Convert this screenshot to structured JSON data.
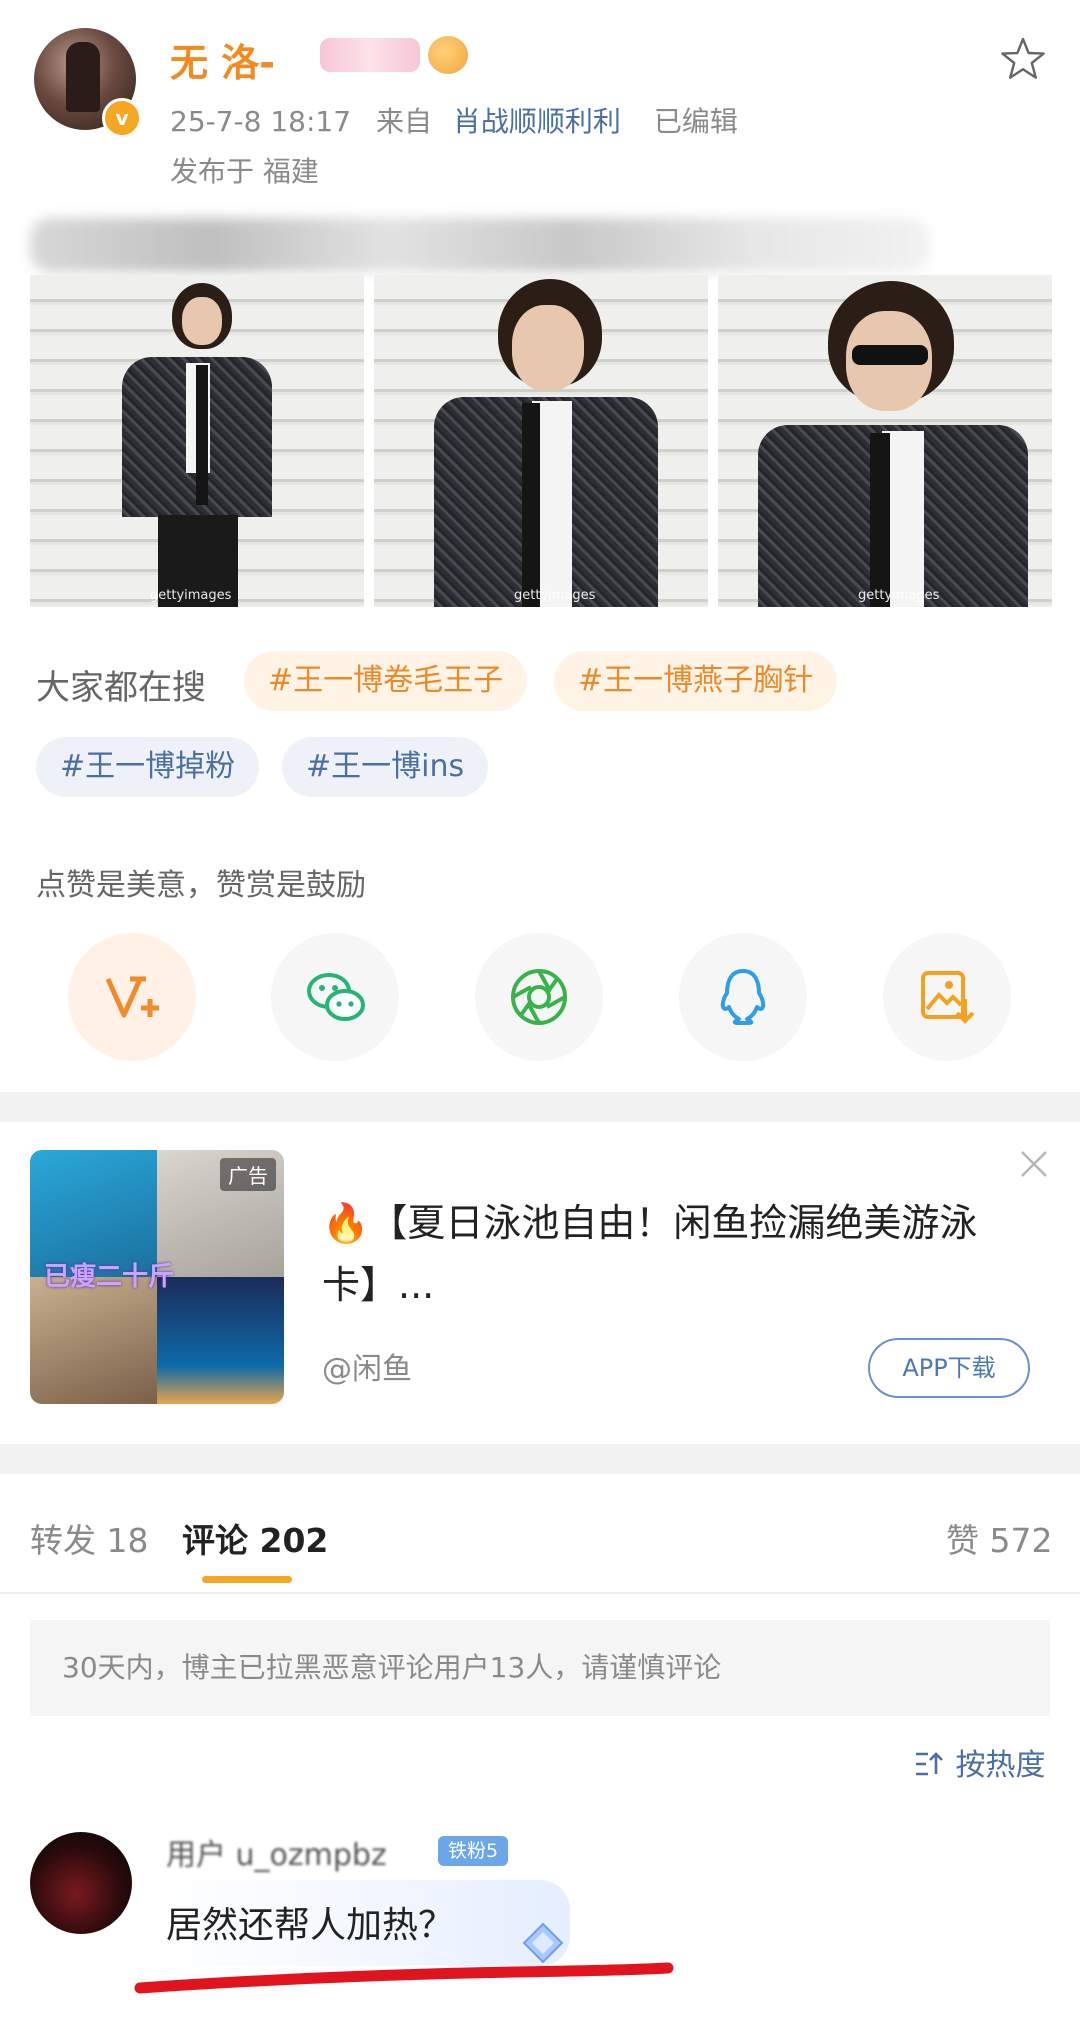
{
  "post": {
    "username": "无 洛-",
    "time": "25-7-8 18:17",
    "from_label": "来自",
    "source": "肖战顺顺利利",
    "edited": "已编辑",
    "location": "发布于 福建",
    "photo_watermark": "gettyimages",
    "verified_badge": "v"
  },
  "search": {
    "label": "大家都在搜",
    "tags": [
      "#王一博卷毛王子",
      "#王一博燕子胸针",
      "#王一博掉粉",
      "#王一博ins"
    ]
  },
  "share": {
    "hint": "点赞是美意，赞赏是鼓励",
    "items": [
      "reward-v-icon",
      "wechat-icon",
      "moments-icon",
      "qq-icon",
      "save-image-icon"
    ]
  },
  "ad": {
    "tag": "广告",
    "overlay_text": "已瘦二十斤",
    "title": "🔥【夏日泳池自由！闲鱼捡漏绝美游泳卡】...",
    "source": "@闲鱼",
    "button": "APP下载"
  },
  "tabs": {
    "repost": "转发 18",
    "comments": "评论 202",
    "likes": "赞 572"
  },
  "notice": "30天内，博主已拉黑恶意评论用户13人，请谨慎评论",
  "sort_label": "按热度",
  "comment": {
    "username": "用户 u_ozmpbz",
    "badge": "铁粉5",
    "text": "居然还帮人加热？"
  },
  "colors": {
    "accent_orange": "#f28b1e",
    "link_blue": "#4a6fa5",
    "tab_underline": "#f5a623",
    "annotation_red": "#e0141e"
  }
}
